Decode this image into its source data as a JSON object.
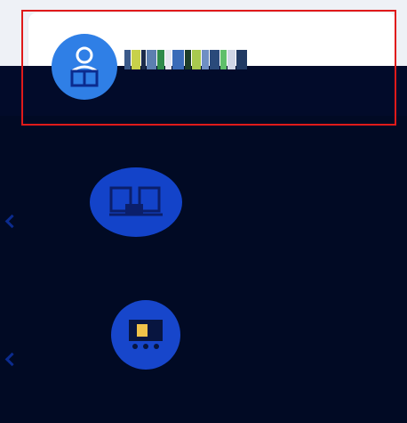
{
  "items": [
    {
      "icon": "user-reading-icon",
      "label": ""
    },
    {
      "icon": "classroom-icon",
      "label": ""
    },
    {
      "icon": "blackboard-icon",
      "label": ""
    }
  ],
  "colors": {
    "accent": "#2f7fe6",
    "icon_blue": "#1746cb",
    "dark_bg": "#020b2a",
    "highlight": "#e01a1a",
    "card": "#ffffff"
  }
}
